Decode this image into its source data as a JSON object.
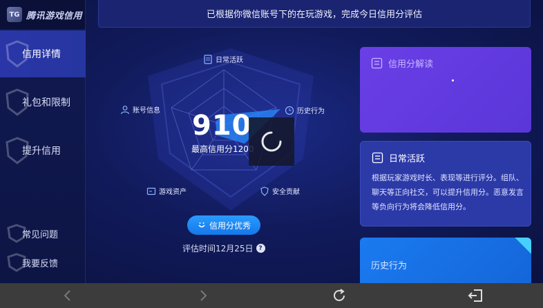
{
  "brand": {
    "name": "腾讯游戏信用",
    "logo_text": "TG"
  },
  "sidebar": {
    "items": [
      {
        "label": "信用详情",
        "active": true
      },
      {
        "label": "礼包和限制",
        "active": false
      },
      {
        "label": "提升信用",
        "active": false
      }
    ],
    "bottom_items": [
      {
        "label": "常见问题"
      },
      {
        "label": "我要反馈"
      }
    ]
  },
  "banner": {
    "text": "已根据你微信账号下的在玩游戏，完成今日信用分评估"
  },
  "radar": {
    "labels": {
      "daily": "日常活跃",
      "history": "历史行为",
      "security": "安全贡献",
      "assets": "游戏资产",
      "account": "账号信息"
    }
  },
  "score": {
    "value": "910",
    "max_text": "最高信用分1200"
  },
  "grade_button": {
    "label": "信用分优秀"
  },
  "eval_time": {
    "text": "评估时间12月25日",
    "help": "?"
  },
  "cards": {
    "interpret": {
      "title": "信用分解读"
    },
    "daily": {
      "title": "日常活跃",
      "body": "根据玩家游戏时长、表现等进行评分。组队、聊天等正向社交，可以提升信用分。恶意发言等负向行为将会降低信用分。"
    },
    "history": {
      "title": "历史行为"
    }
  },
  "colors": {
    "accent": "#1677e8",
    "purple_card": "#6a3fe6",
    "navy": "#0b1240"
  }
}
